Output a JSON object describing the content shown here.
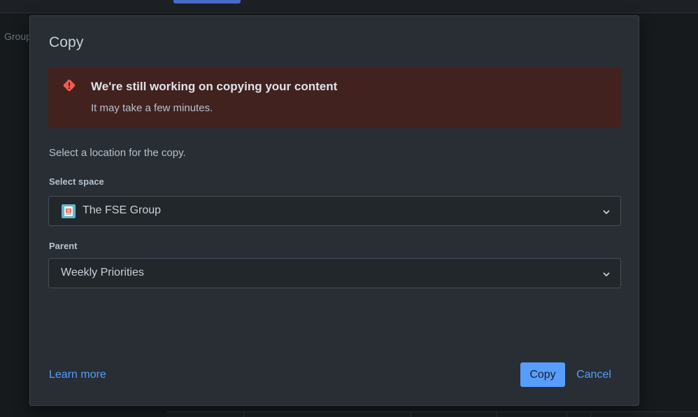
{
  "background": {
    "sidebar_text": "Group"
  },
  "modal": {
    "title": "Copy",
    "alert": {
      "icon": "warning-icon",
      "title": "We're still working on copying your content",
      "body": "It may take a few minutes."
    },
    "instruction": "Select a location for the copy.",
    "space_field": {
      "label": "Select space",
      "value": "The FSE Group",
      "icon": "space-avatar-icon"
    },
    "parent_field": {
      "label": "Parent",
      "value": "Weekly Priorities"
    },
    "footer": {
      "learn_more": "Learn more",
      "copy_button": "Copy",
      "cancel_button": "Cancel"
    }
  },
  "colors": {
    "accent": "#579dff",
    "alert_bg": "#42221f",
    "alert_icon": "#f15b50",
    "modal_bg": "#282e33"
  }
}
